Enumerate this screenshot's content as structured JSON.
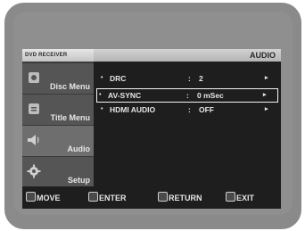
{
  "header": {
    "device_label": "DVD RECEIVER",
    "section_label": "AUDIO"
  },
  "sidebar": {
    "items": [
      {
        "label": "Disc Menu",
        "icon": "disc-icon"
      },
      {
        "label": "Title Menu",
        "icon": "title-icon"
      },
      {
        "label": "Audio",
        "icon": "speaker-icon",
        "active": true
      },
      {
        "label": "Setup",
        "icon": "gear-icon"
      }
    ]
  },
  "menu": {
    "rows": [
      {
        "name": "DRC",
        "colon": ":",
        "value": "2",
        "arrow": "▸",
        "selected": false
      },
      {
        "name": "AV-SYNC",
        "colon": ":",
        "value": "0 mSec",
        "arrow": "▸",
        "selected": true
      },
      {
        "name": "HDMI AUDIO",
        "colon": ":",
        "value": "OFF",
        "arrow": "▸",
        "selected": false
      }
    ],
    "bullet": "•"
  },
  "footer": {
    "move": "MOVE",
    "enter": "ENTER",
    "return": "RETURN",
    "exit": "EXIT"
  },
  "colors": {
    "screen_bg": "#1e1e1e",
    "bezel": "#8a8a8a",
    "sidebar_active": "#6e6e6e"
  }
}
